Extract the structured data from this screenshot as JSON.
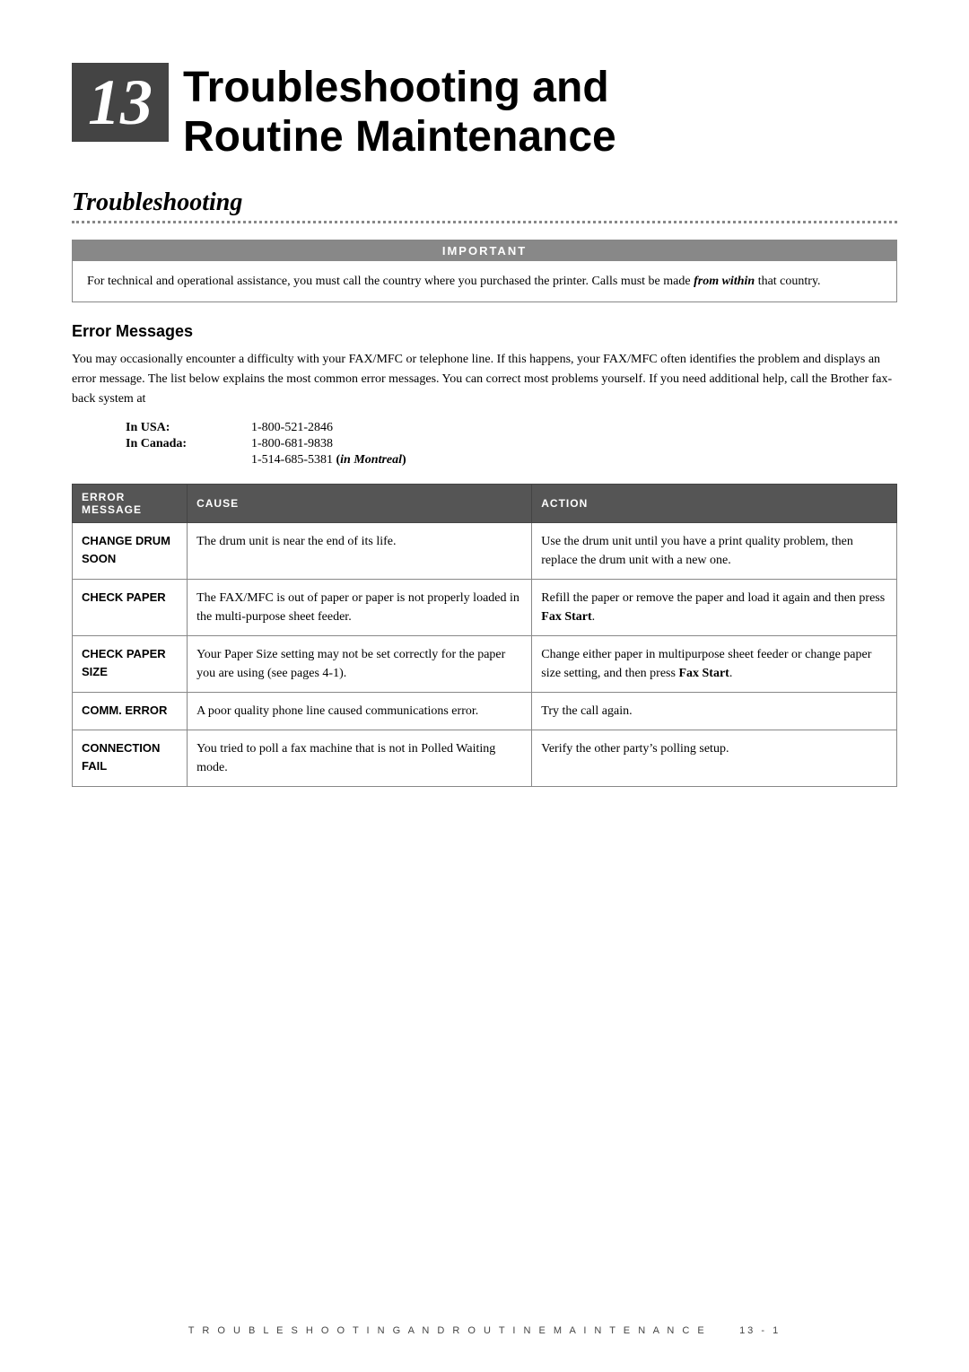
{
  "chapter": {
    "number": "13",
    "title_line1": "Troubleshooting and",
    "title_line2": "Routine Maintenance"
  },
  "section": {
    "title": "Troubleshooting"
  },
  "important_box": {
    "header": "IMPORTANT",
    "body": "For technical and operational assistance, you must call the country where you purchased the printer. Calls must be made ",
    "body_bold_italic": "from within",
    "body_end": " that country."
  },
  "error_messages_section": {
    "title": "Error Messages",
    "intro": "You may occasionally encounter a difficulty with your FAX/MFC or telephone line. If this happens, your FAX/MFC often identifies the problem and displays an error message. The list below explains the most common error messages. You can correct most problems yourself. If you need additional help, call the Brother fax-back system at",
    "contacts": [
      {
        "label": "In USA:",
        "value": "1-800-521-2846"
      },
      {
        "label": "In Canada:",
        "value": "1-800-681-9838"
      },
      {
        "label": "",
        "value": "1-514-685-5381",
        "suffix": " (in Montreal)"
      }
    ],
    "table_headers": [
      "ERROR MESSAGE",
      "CAUSE",
      "ACTION"
    ],
    "table_rows": [
      {
        "error": "CHANGE DRUM\nSOON",
        "cause": "The drum unit is near the end of its life.",
        "action": "Use the drum unit until you have a print quality problem, then replace the drum unit with a new one."
      },
      {
        "error": "CHECK PAPER",
        "cause": "The FAX/MFC is out of paper or paper is not properly loaded in the multi-purpose sheet feeder.",
        "action_pre": "Refill the paper or remove the paper and load it again and then press ",
        "action_bold": "Fax Start",
        "action_post": ".",
        "has_bold_action": true
      },
      {
        "error": "CHECK PAPER\nSIZE",
        "cause": "Your Paper Size setting may not be set correctly for the paper you are using (see pages 4-1).",
        "action_pre": "Change either paper in multipurpose sheet feeder or change paper size setting, and then press ",
        "action_bold": "Fax Start",
        "action_post": ".",
        "has_bold_action": true
      },
      {
        "error": "COMM. ERROR",
        "cause": "A poor quality phone line caused communications error.",
        "action": "Try the call again."
      },
      {
        "error": "CONNECTION\nFAIL",
        "cause": "You tried to poll a fax machine that is not in Polled Waiting mode.",
        "action_pre": "Verify the other party’s polling setup.",
        "has_bold_action": false
      }
    ]
  },
  "footer": {
    "text": "T R O U B L E S H O O T I N G   A N D   R O U T I N E   M A I N T E N A N C E",
    "page": "13 - 1"
  }
}
